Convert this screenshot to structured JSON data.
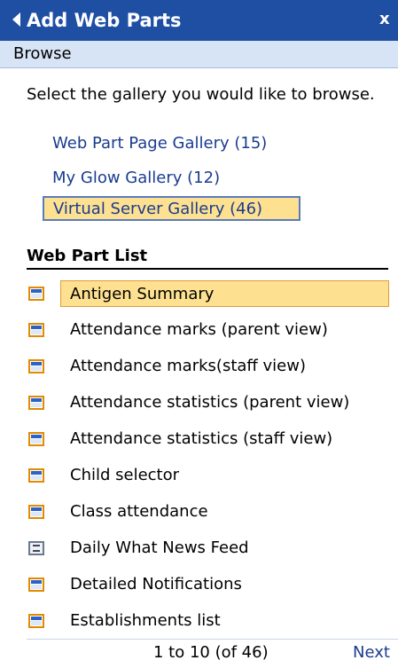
{
  "panel": {
    "title": "Add Web Parts",
    "close_glyph": "x",
    "back_icon": "triangle-left-icon"
  },
  "browse": {
    "label": "Browse"
  },
  "instructions": "Select the gallery you would like to browse.",
  "galleries": [
    {
      "label": "Web Part Page Gallery (15)"
    },
    {
      "label": "My Glow Gallery (12)"
    },
    {
      "label": "Virtual Server Gallery (46)",
      "selected": true
    }
  ],
  "web_part_list": {
    "title": "Web Part List",
    "items": [
      {
        "label": "Antigen Summary",
        "icon": "web-part-icon",
        "selected": true
      },
      {
        "label": "Attendance marks (parent view)",
        "icon": "web-part-icon"
      },
      {
        "label": "Attendance marks(staff view)",
        "icon": "web-part-icon"
      },
      {
        "label": "Attendance statistics (parent view)",
        "icon": "web-part-icon"
      },
      {
        "label": "Attendance statistics (staff view)",
        "icon": "web-part-icon"
      },
      {
        "label": "Child selector",
        "icon": "web-part-icon"
      },
      {
        "label": "Class attendance",
        "icon": "web-part-icon"
      },
      {
        "label": "Daily What News Feed",
        "icon": "news-feed-icon"
      },
      {
        "label": "Detailed Notifications",
        "icon": "web-part-icon"
      },
      {
        "label": "Establishments list",
        "icon": "web-part-icon"
      }
    ]
  },
  "paging": {
    "summary": "1 to 10 (of 46)",
    "next_label": "Next"
  },
  "colors": {
    "title_bar": "#1f4fa3",
    "sub_bar": "#d7e4f6",
    "selection": "#fde090",
    "link": "#1a3c8f"
  }
}
